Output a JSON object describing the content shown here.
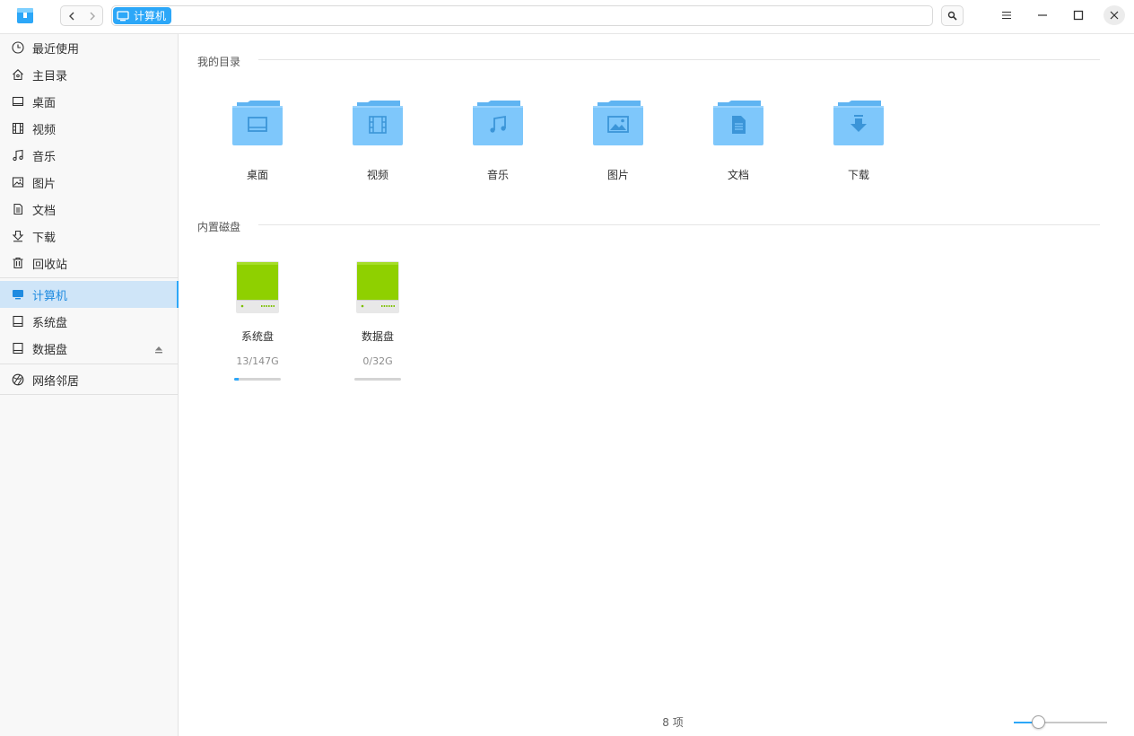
{
  "titlebar": {
    "breadcrumb": "计算机",
    "icons": {
      "logo": "file-manager-logo",
      "back": "chevron-left-icon",
      "forward": "chevron-right-icon",
      "search": "search-icon",
      "menu": "menu-icon",
      "minimize": "minimize-icon",
      "maximize": "maximize-icon",
      "close": "close-icon"
    }
  },
  "sidebar": {
    "items": [
      {
        "label": "最近使用",
        "icon": "clock-icon"
      },
      {
        "label": "主目录",
        "icon": "home-icon"
      },
      {
        "label": "桌面",
        "icon": "desktop-icon"
      },
      {
        "label": "视频",
        "icon": "film-icon"
      },
      {
        "label": "音乐",
        "icon": "music-icon"
      },
      {
        "label": "图片",
        "icon": "image-icon"
      },
      {
        "label": "文档",
        "icon": "document-icon"
      },
      {
        "label": "下载",
        "icon": "download-icon"
      },
      {
        "label": "回收站",
        "icon": "trash-icon"
      },
      {
        "label": "计算机",
        "icon": "computer-icon",
        "active": true
      },
      {
        "label": "系统盘",
        "icon": "disk-icon"
      },
      {
        "label": "数据盘",
        "icon": "disk-icon",
        "eject": true
      },
      {
        "label": "网络邻居",
        "icon": "network-icon"
      }
    ]
  },
  "content": {
    "my_dirs_title": "我的目录",
    "folders": [
      {
        "label": "桌面",
        "icon": "desktop-folder-icon"
      },
      {
        "label": "视频",
        "icon": "video-folder-icon"
      },
      {
        "label": "音乐",
        "icon": "music-folder-icon"
      },
      {
        "label": "图片",
        "icon": "pictures-folder-icon"
      },
      {
        "label": "文档",
        "icon": "documents-folder-icon"
      },
      {
        "label": "下载",
        "icon": "downloads-folder-icon"
      }
    ],
    "disks_title": "内置磁盘",
    "disks": [
      {
        "label": "系统盘",
        "usage": "13/147G",
        "used_fraction": 0.088
      },
      {
        "label": "数据盘",
        "usage": "0/32G",
        "used_fraction": 0.0
      }
    ]
  },
  "status": {
    "count": "8 项",
    "zoom_fraction": 0.27
  },
  "colors": {
    "accent": "#2ca7f8",
    "folder": "#7ec7fb",
    "folder_dark": "#5fb4f2",
    "disk_green": "#8fd000"
  }
}
